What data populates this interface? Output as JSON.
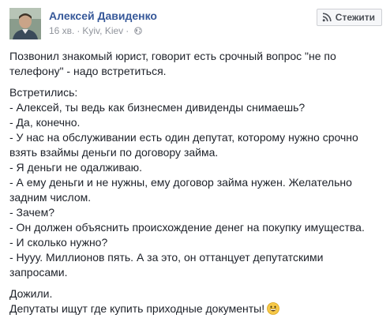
{
  "post": {
    "author": "Алексей Давиденко",
    "time": "16 хв.",
    "separator": "·",
    "location": "Kyiv, Kiev",
    "location_separator": "·",
    "privacy_icon": "globe-icon",
    "follow_icon": "rss-icon",
    "follow_label": "Стежити",
    "paragraphs": [
      {
        "lines": [
          "Позвонил знакомый юрист, говорит есть срочный вопрос \"не по",
          "телефону\" - надо встретиться."
        ]
      },
      {
        "lines": [
          "Встретились:",
          "- Алексей, ты ведь как бизнесмен дивиденды снимаешь?",
          "- Да, конечно.",
          "- У нас на обслуживании есть один депутат, которому нужно срочно",
          "взять взаймы деньги по договору займа.",
          "- Я деньги не одалживаю.",
          "- А ему деньги и не нужны, ему договор займа нужен. Желательно",
          "задним числом.",
          "- Зачем?",
          "- Он должен объяснить происхождение денег на покупку имущества.",
          "- И сколько нужно?",
          "- Нууу. Миллионов пять. А за это, он оттанцует депутатскими",
          "запросами."
        ]
      },
      {
        "lines": [
          "Дожили.",
          "Депутаты ищут где купить приходные документы!"
        ],
        "emoji": "grinning-face-icon"
      }
    ]
  }
}
